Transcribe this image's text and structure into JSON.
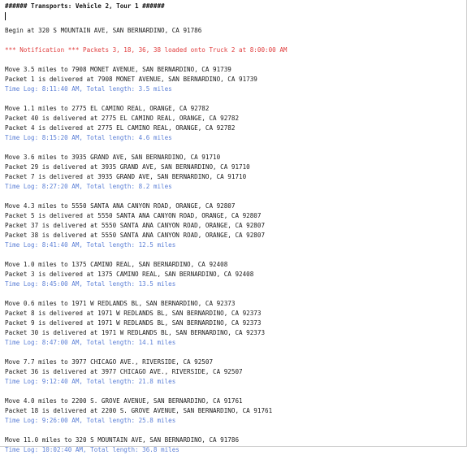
{
  "header": "###### Transports: Vehicle 2, Tour 1 ######",
  "begin": "Begin at 320 S MOUNTAIN AVE, SAN BERNARDINO, CA 91786",
  "notification": "*** Notification *** Packets 3, 18, 36, 38 loaded onto Truck 2 at 8:00:00 AM",
  "blocks": [
    {
      "move": "Move 3.5 miles to 7908 MONET AVENUE, SAN BERNARDINO, CA 91739",
      "deliveries": [
        "Packet 1 is delivered at 7908 MONET AVENUE, SAN BERNARDINO, CA 91739"
      ],
      "timelog": "Time Log: 8:11:40 AM, Total length: 3.5 miles"
    },
    {
      "move": "Move 1.1 miles to 2775 EL CAMINO REAL, ORANGE, CA 92782",
      "deliveries": [
        "Packet 40 is delivered at 2775 EL CAMINO REAL, ORANGE, CA 92782",
        "Packet 4 is delivered at 2775 EL CAMINO REAL, ORANGE, CA 92782"
      ],
      "timelog": "Time Log: 8:15:20 AM, Total length: 4.6 miles"
    },
    {
      "move": "Move 3.6 miles to 3935 GRAND AVE, SAN BERNARDINO, CA 91710",
      "deliveries": [
        "Packet 29 is delivered at 3935 GRAND AVE, SAN BERNARDINO, CA 91710",
        "Packet 7 is delivered at 3935 GRAND AVE, SAN BERNARDINO, CA 91710"
      ],
      "timelog": "Time Log: 8:27:20 AM, Total length: 8.2 miles"
    },
    {
      "move": "Move 4.3 miles to 5550 SANTA ANA CANYON ROAD, ORANGE, CA 92807",
      "deliveries": [
        "Packet 5 is delivered at 5550 SANTA ANA CANYON ROAD, ORANGE, CA 92807",
        "Packet 37 is delivered at 5550 SANTA ANA CANYON ROAD, ORANGE, CA 92807",
        "Packet 38 is delivered at 5550 SANTA ANA CANYON ROAD, ORANGE, CA 92807"
      ],
      "timelog": "Time Log: 8:41:40 AM, Total length: 12.5 miles"
    },
    {
      "move": "Move 1.0 miles to 1375 CAMINO REAL, SAN BERNARDINO, CA 92408",
      "deliveries": [
        "Packet 3 is delivered at 1375 CAMINO REAL, SAN BERNARDINO, CA 92408"
      ],
      "timelog": "Time Log: 8:45:00 AM, Total length: 13.5 miles"
    },
    {
      "move": "Move 0.6 miles to 1971 W REDLANDS BL, SAN BERNARDINO, CA 92373",
      "deliveries": [
        "Packet 8 is delivered at 1971 W REDLANDS BL, SAN BERNARDINO, CA 92373",
        "Packet 9 is delivered at 1971 W REDLANDS BL, SAN BERNARDINO, CA 92373",
        "Packet 30 is delivered at 1971 W REDLANDS BL, SAN BERNARDINO, CA 92373"
      ],
      "timelog": "Time Log: 8:47:00 AM, Total length: 14.1 miles"
    },
    {
      "move": "Move 7.7 miles to 3977 CHICAGO AVE., RIVERSIDE, CA 92507",
      "deliveries": [
        "Packet 36 is delivered at 3977 CHICAGO AVE., RIVERSIDE, CA 92507"
      ],
      "timelog": "Time Log: 9:12:40 AM, Total length: 21.8 miles"
    },
    {
      "move": "Move 4.0 miles to 2200 S. GROVE AVENUE, SAN BERNARDINO, CA 91761",
      "deliveries": [
        "Packet 18 is delivered at 2200 S. GROVE AVENUE, SAN BERNARDINO, CA 91761"
      ],
      "timelog": "Time Log: 9:26:00 AM, Total length: 25.8 miles"
    },
    {
      "move": "Move 11.0 miles to 320 S MOUNTAIN AVE, SAN BERNARDINO, CA 91786",
      "deliveries": [],
      "timelog": "Time Log: 10:02:40 AM, Total length: 36.8 miles"
    }
  ]
}
